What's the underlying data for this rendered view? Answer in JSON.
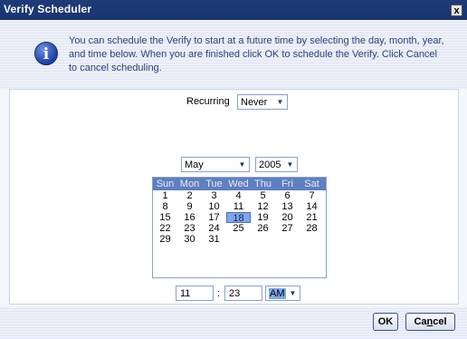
{
  "window": {
    "title": "Verify Scheduler",
    "close_symbol": "x"
  },
  "info": {
    "icon_glyph": "i",
    "line1": "You can schedule the Verify to start at a future time by selecting the day, month, year,",
    "line2": "and time below.  When you are finished click OK to schedule the Verify.  Click Cancel",
    "line3": "to cancel scheduling."
  },
  "recurring": {
    "label": "Recurring",
    "value": "Never"
  },
  "calendar": {
    "month": "May",
    "year": "2005",
    "day_headers": [
      "Sun",
      "Mon",
      "Tue",
      "Wed",
      "Thu",
      "Fri",
      "Sat"
    ],
    "weeks": [
      [
        "1",
        "2",
        "3",
        "4",
        "5",
        "6",
        "7"
      ],
      [
        "8",
        "9",
        "10",
        "11",
        "12",
        "13",
        "14"
      ],
      [
        "15",
        "16",
        "17",
        "18",
        "19",
        "20",
        "21"
      ],
      [
        "22",
        "23",
        "24",
        "25",
        "26",
        "27",
        "28"
      ],
      [
        "29",
        "30",
        "31",
        "",
        "",
        "",
        ""
      ]
    ],
    "selected_day": "18"
  },
  "time": {
    "hour": "11",
    "separator": ":",
    "minute": "23",
    "ampm": "AM"
  },
  "buttons": {
    "ok": "OK",
    "cancel_pre": "Ca",
    "cancel_mnemonic": "n",
    "cancel_post": "cel"
  }
}
